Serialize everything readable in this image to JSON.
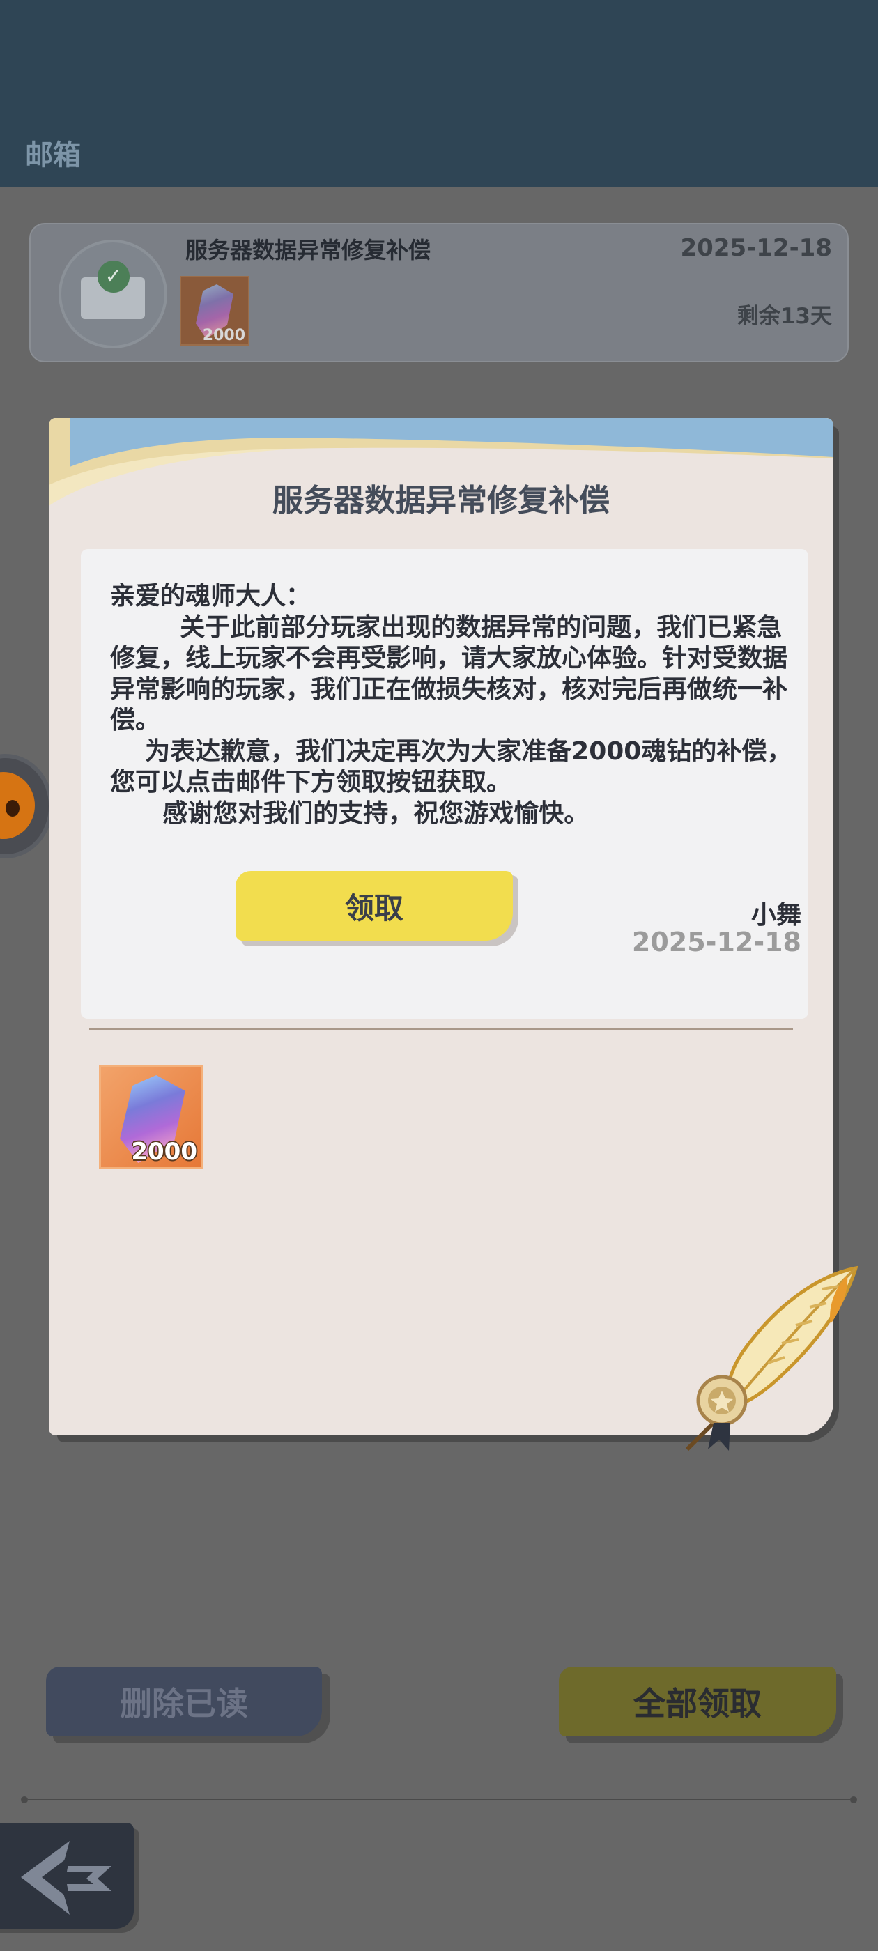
{
  "header": {
    "title": "邮箱"
  },
  "mail_list": [
    {
      "subject": "服务器数据异常修复补偿",
      "date": "2025-12-18",
      "remaining": "剩余13天",
      "attachment_qty": "2000",
      "icon": "envelope-check-icon"
    }
  ],
  "modal": {
    "title": "服务器数据异常修复补偿",
    "body": "亲爱的魂师大人：\n        关于此前部分玩家出现的数据异常的问题，我们已紧急修复，线上玩家不会再受影响，请大家放心体验。针对受数据异常影响的玩家，我们正在做损失核对，核对完后再做统一补偿。\n    为表达歉意，我们决定再次为大家准备2000魂钻的补偿，您可以点击邮件下方领取按钮获取。\n      感谢您对我们的支持，祝您游戏愉快。",
    "signature": "小舞",
    "signature_date": "2025-12-18",
    "reward": {
      "icon": "soul-diamond-icon",
      "qty": "2000"
    },
    "claim_label": "领取"
  },
  "footer": {
    "delete_read_label": "删除已读",
    "claim_all_label": "全部领取",
    "back_icon": "back-arrow-icon"
  },
  "colors": {
    "header_bg": "#2f4555",
    "modal_bg": "#ece4e0",
    "claim_button": "#f2dd4e",
    "reward_bg": "#e67837"
  }
}
